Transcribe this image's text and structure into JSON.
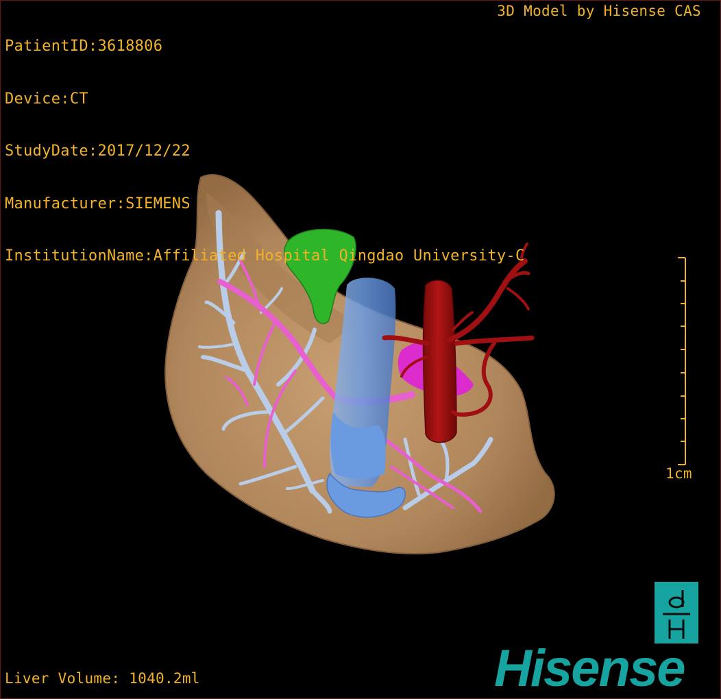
{
  "overlay": {
    "patient_id": "PatientID:3618806",
    "device": "Device:CT",
    "study_date": "StudyDate:2017/12/22",
    "manufacturer": "Manufacturer:SIEMENS",
    "institution": "InstitutionName:Affiliated Hospital Qingdao University-C",
    "model_caption": "3D Model by Hisense CAS",
    "liver_volume": "Liver Volume: 1040.2ml",
    "scale_label": "1cm"
  },
  "brand": {
    "wordmark": "Hisense",
    "logo_letters": "dH",
    "color": "#17a3a0"
  },
  "colors": {
    "overlay_text": "#f2b32a",
    "liver": "#c79a6b",
    "gallbladder": "#2fb52a",
    "hepatic_vein": "#b9cde8",
    "portal_vein": "#e85fd0",
    "ivc": "#6a9ae0",
    "aorta": "#9e0f10",
    "tumor": "#e020d8"
  },
  "scene": {
    "structures": [
      "liver",
      "gallbladder",
      "hepatic-veins",
      "portal-veins",
      "inferior-vena-cava",
      "aorta",
      "lesion"
    ]
  }
}
